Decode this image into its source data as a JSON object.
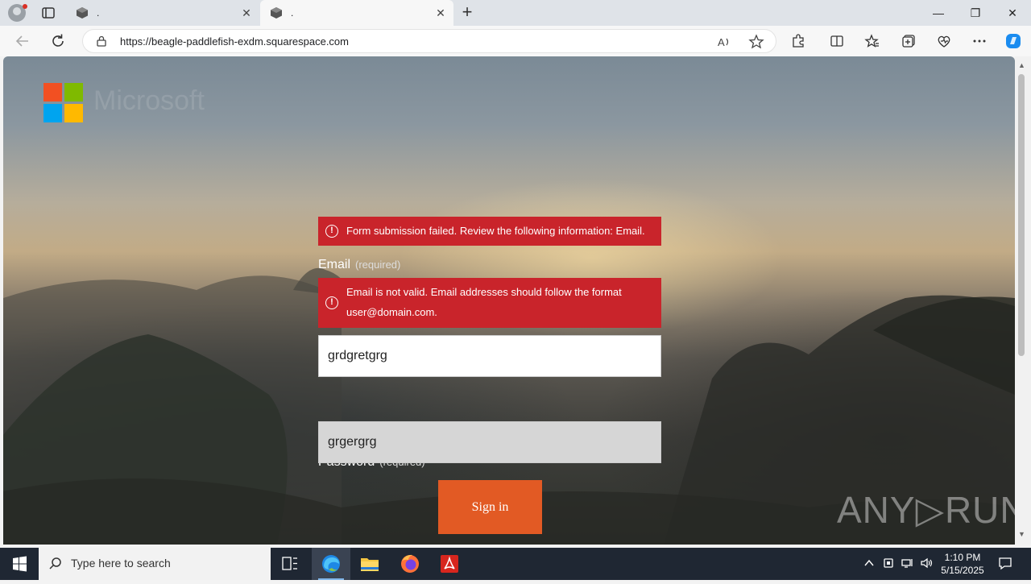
{
  "browser": {
    "tabs": [
      {
        "title": "."
      },
      {
        "title": "."
      }
    ],
    "url": "https://beagle-paddlefish-exdm.squarespace.com"
  },
  "page": {
    "brand": "Microsoft",
    "form_error": "Form submission failed. Review the following information: Email.",
    "email": {
      "label": "Email",
      "required": "(required)",
      "error_line1": "Email is not valid. Email addresses should follow the format",
      "error_line2": "user@domain.com.",
      "value": "grdgretgrg"
    },
    "password": {
      "label": "Password",
      "required": "(required)",
      "value": "grgergrg"
    },
    "signin_label": "Sign in",
    "watermark": "ANY▷RUN"
  },
  "colors": {
    "error_red": "#c9242b",
    "button_orange": "#e25a24"
  },
  "taskbar": {
    "search_placeholder": "Type here to search",
    "time": "1:10 PM",
    "date": "5/15/2025"
  }
}
